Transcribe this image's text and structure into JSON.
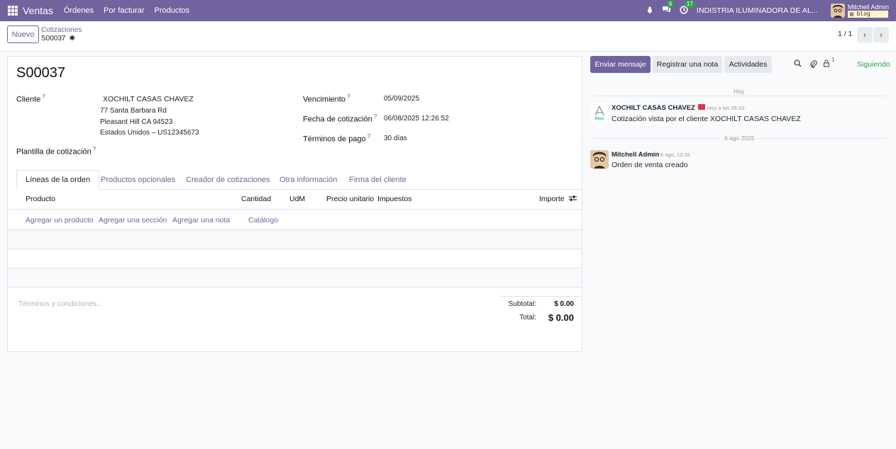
{
  "navbar": {
    "app_name": "Ventas",
    "menu": [
      "Órdenes",
      "Por facturar",
      "Productos"
    ],
    "chat_badge": "6",
    "activity_badge": "17",
    "company": "INDISTRIA ILUMINADORA DE AL...",
    "user_name": "Mitchell Admin",
    "db_name": "blog",
    "accent_color": "#71639e"
  },
  "control": {
    "new_button": "Nuevo",
    "breadcrumb_parent": "Cotizaciones",
    "breadcrumb_current": "S00037",
    "pager": "1 / 1"
  },
  "form": {
    "title": "S00037",
    "customer_label": "Cliente",
    "customer_name": "XOCHILT CASAS CHAVEZ",
    "address_line1": "77 Santa Barbara Rd",
    "address_line2": "Pleasant Hill CA 94523",
    "address_line3": "Estados Unidos – US12345673",
    "template_label": "Plantilla de cotización",
    "expiration_label": "Vencimiento",
    "expiration_value": "05/09/2025",
    "quote_date_label": "Fecha de cotización",
    "quote_date_value": "06/08/2025 12:26:52",
    "payment_terms_label": "Términos de pago",
    "payment_terms_value": "30 días",
    "tabs": [
      "Líneas de la orden",
      "Productos opcionales",
      "Creador de cotizaciones",
      "Otra información",
      "Firma del cliente"
    ],
    "columns": [
      "Producto",
      "Cantidad",
      "UdM",
      "Precio unitario",
      "Impuestos",
      "Importe"
    ],
    "add_links": [
      "Agregar un producto",
      "Agregar una sección",
      "Agregar una nota",
      "Catálogo"
    ],
    "terms_placeholder": "Términos y condiciones...",
    "subtotal_label": "Subtotal:",
    "subtotal_value": "$ 0.00",
    "total_label": "Total:",
    "total_value": "$ 0.00"
  },
  "chatter": {
    "send_message": "Enviar mensaje",
    "log_note": "Registrar una nota",
    "activities": "Actividades",
    "followers_count": "1",
    "following": "Siguiendo",
    "sep_today": "Hoy",
    "msg1_author": "XOCHILT CASAS CHAVEZ",
    "msg1_time": "Hoy a las 09:10",
    "msg1_body": "Cotización vista por el cliente XOCHILT CASAS CHAVEZ",
    "sep_date": "6 ago 2025",
    "msg2_author": "Mitchell Admin",
    "msg2_time": "6 ago, 12:26",
    "msg2_body": "Orden de venta creado",
    "logo_text": "Deco"
  }
}
